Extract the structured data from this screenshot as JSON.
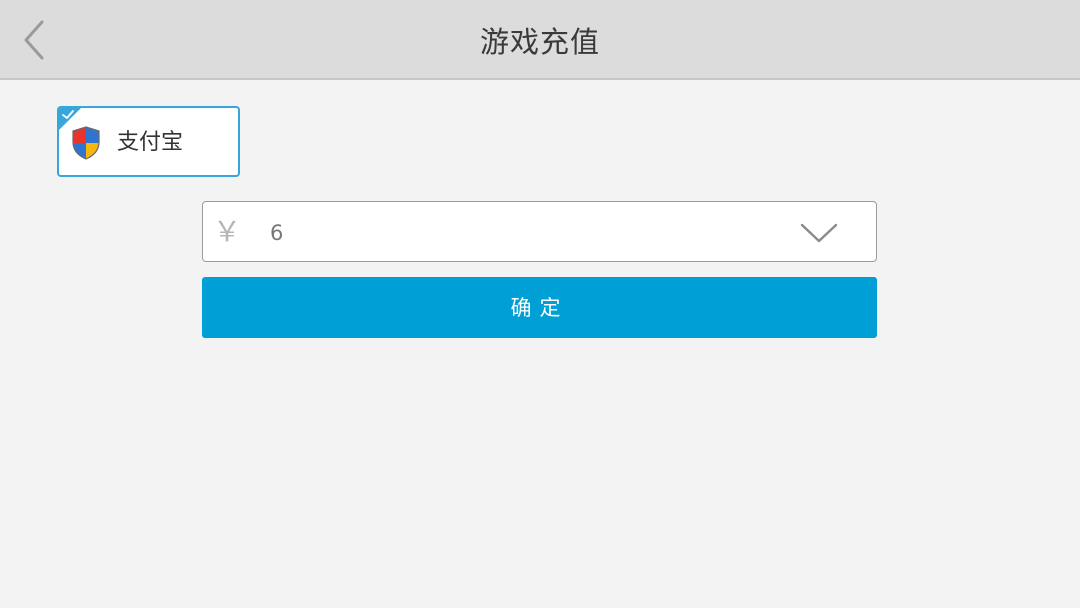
{
  "header": {
    "title": "游戏充值"
  },
  "payment": {
    "selected_method_label": "支付宝",
    "selected": true
  },
  "amount": {
    "currency_symbol": "￥",
    "value": "6"
  },
  "confirm": {
    "label": "确定"
  },
  "colors": {
    "accent": "#009fd6",
    "header_bg": "#dcdcdc",
    "page_bg": "#f3f3f3",
    "selection_border": "#39a6db"
  },
  "icons": {
    "back": "chevron-left-icon",
    "check": "check-icon",
    "payment": "shield-icon",
    "dropdown": "chevron-down-icon"
  }
}
